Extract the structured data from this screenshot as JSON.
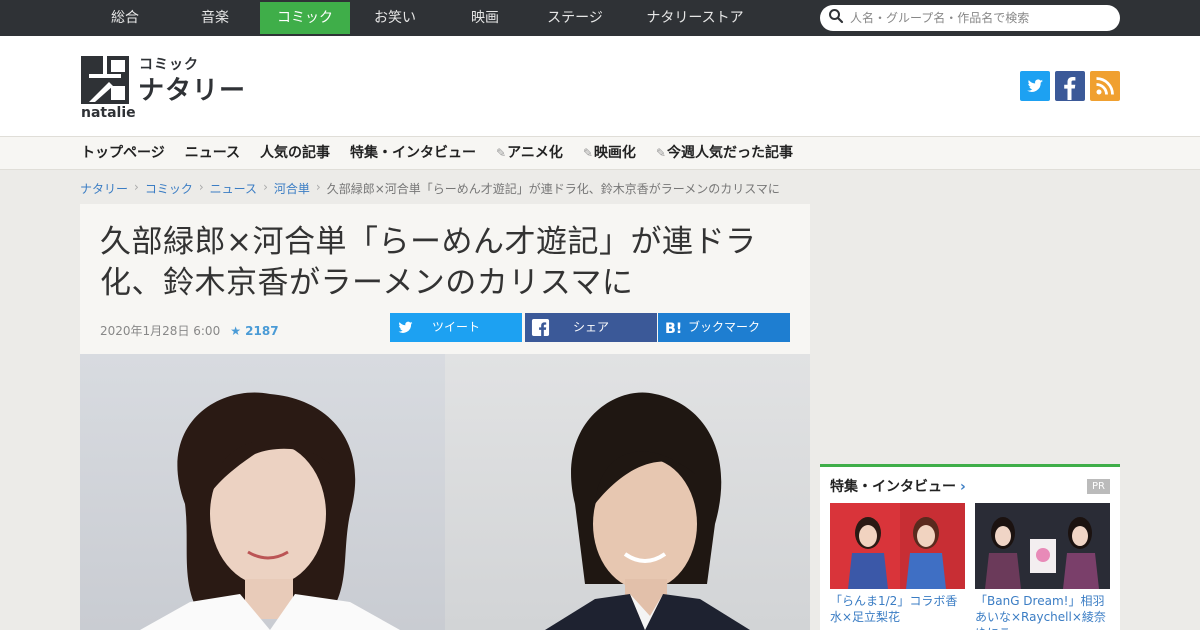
{
  "topnav": {
    "items": [
      {
        "label": "総合"
      },
      {
        "label": "音楽"
      },
      {
        "label": "コミック"
      },
      {
        "label": "お笑い"
      },
      {
        "label": "映画"
      },
      {
        "label": "ステージ"
      },
      {
        "label": "ナタリーストア"
      }
    ],
    "active": "コミック"
  },
  "search": {
    "placeholder": "人名・グループ名・作品名で検索"
  },
  "logo": {
    "sub": "コミック",
    "main": "ナタリー",
    "en": "natalie"
  },
  "subnav": {
    "items": [
      {
        "label": "トップページ"
      },
      {
        "label": "ニュース"
      },
      {
        "label": "人気の記事"
      },
      {
        "label": "特集・インタビュー"
      },
      {
        "label": "アニメ化"
      },
      {
        "label": "映画化"
      },
      {
        "label": "今週人気だった記事"
      }
    ]
  },
  "breadcrumb": {
    "items": [
      "ナタリー",
      "コミック",
      "ニュース",
      "河合単"
    ],
    "current": "久部緑郎×河合単「らーめん才遊記」が連ドラ化、鈴木京香がラーメンのカリスマに"
  },
  "article": {
    "title": "久部緑郎×河合単「らーめん才遊記」が連ドラ化、鈴木京香がラーメンのカリスマに",
    "date": "2020年1月28日 6:00",
    "stars": "2187",
    "share": {
      "tweet": "ツイート",
      "facebook": "シェア",
      "hatena": "ブックマーク"
    }
  },
  "sidebar": {
    "title": "特集・インタビュー",
    "pr": "PR",
    "cards": [
      {
        "caption": "「らんま1/2」コラボ香水×足立梨花"
      },
      {
        "caption": "「BanG Dream!」相羽あいな×Raychell×綾奈ゆにこ"
      }
    ]
  },
  "colors": {
    "accent": "#3fae49",
    "link": "#3b7dc4",
    "twitter": "#1da1f2",
    "facebook": "#3b5998",
    "hatena": "#1e7ed1",
    "rss": "#f0a030"
  }
}
